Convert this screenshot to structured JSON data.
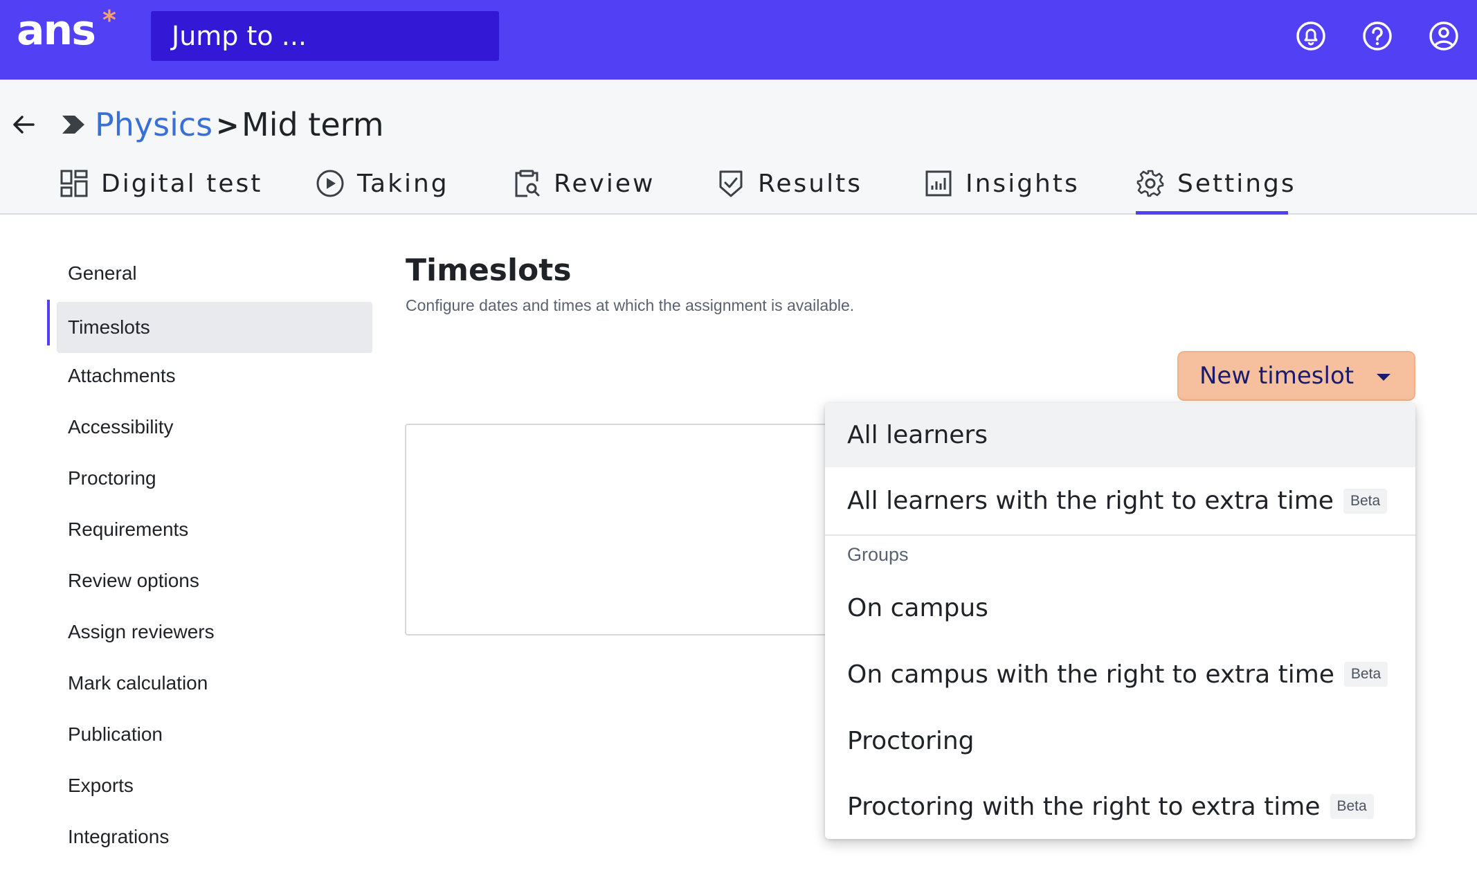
{
  "topbar": {
    "logo_text": "ans",
    "logo_mark": "*",
    "jump_placeholder": "Jump to ...",
    "icons": [
      "bell-icon",
      "help-icon",
      "user-icon"
    ],
    "bg_color": "#5240f4"
  },
  "breadcrumb": {
    "parent": "Physics",
    "separator": ">",
    "current": "Mid term"
  },
  "tabs": [
    {
      "label": "Digital test",
      "icon": "grid-icon"
    },
    {
      "label": "Taking",
      "icon": "play-circle-icon"
    },
    {
      "label": "Review",
      "icon": "clipboard-search-icon"
    },
    {
      "label": "Results",
      "icon": "shield-check-icon"
    },
    {
      "label": "Insights",
      "icon": "bar-chart-icon"
    },
    {
      "label": "Settings",
      "icon": "gear-icon",
      "active": true
    }
  ],
  "sidebar": {
    "items": [
      {
        "label": "General"
      },
      {
        "label": "Timeslots",
        "active": true
      },
      {
        "label": "Attachments"
      },
      {
        "label": "Accessibility"
      },
      {
        "label": "Proctoring"
      },
      {
        "label": "Requirements"
      },
      {
        "label": "Review options"
      },
      {
        "label": "Assign reviewers"
      },
      {
        "label": "Mark calculation"
      },
      {
        "label": "Publication"
      },
      {
        "label": "Exports"
      },
      {
        "label": "Integrations"
      }
    ]
  },
  "main": {
    "title": "Timeslots",
    "subtitle": "Configure dates and times at which the assignment is available.",
    "new_button_label": "New timeslot"
  },
  "dropdown": {
    "items_top": [
      {
        "label": "All learners",
        "badge": ""
      },
      {
        "label": "All learners with the right to extra time",
        "badge": "Beta"
      }
    ],
    "group_label": "Groups",
    "items_group": [
      {
        "label": "On campus",
        "badge": ""
      },
      {
        "label": "On campus with the right to extra time",
        "badge": "Beta"
      },
      {
        "label": "Proctoring",
        "badge": ""
      },
      {
        "label": "Proctoring with the right to extra time",
        "badge": "Beta"
      }
    ]
  },
  "colors": {
    "accent": "#5240f4",
    "link": "#3a6fd8",
    "button_bg": "#f6c09f"
  }
}
